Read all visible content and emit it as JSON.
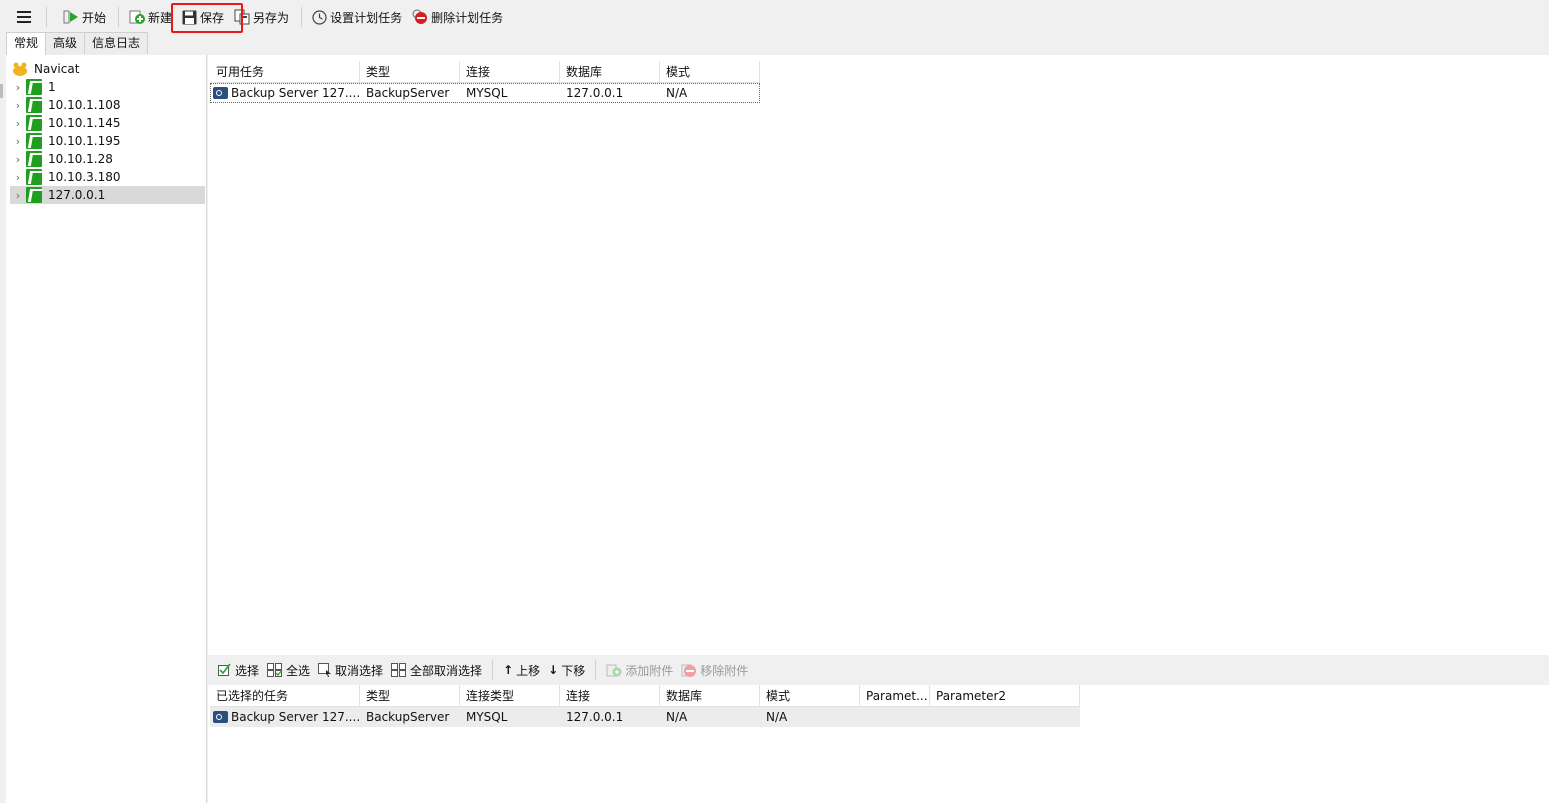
{
  "toolbar": {
    "start": "开始",
    "new": "新建",
    "save": "保存",
    "save_as": "另存为",
    "set_schedule": "设置计划任务",
    "delete_schedule": "删除计划任务"
  },
  "tabs": [
    "常规",
    "高级",
    "信息日志"
  ],
  "tree": {
    "root": "Navicat",
    "connections": [
      "1",
      "10.10.1.108",
      "10.10.1.145",
      "10.10.1.195",
      "10.10.1.28",
      "10.10.3.180",
      "127.0.0.1"
    ],
    "selected": "127.0.0.1"
  },
  "available_tasks": {
    "headers": [
      "可用任务",
      "类型",
      "连接",
      "数据库",
      "模式"
    ],
    "rows": [
      [
        "Backup Server 127....",
        "BackupServer",
        "MYSQL",
        "127.0.0.1",
        "N/A"
      ]
    ]
  },
  "bottom_toolbar": {
    "select": "选择",
    "select_all": "全选",
    "deselect": "取消选择",
    "deselect_all": "全部取消选择",
    "move_up": "上移",
    "move_down": "下移",
    "add_attachment": "添加附件",
    "remove_attachment": "移除附件"
  },
  "selected_tasks": {
    "headers": [
      "已选择的任务",
      "类型",
      "连接类型",
      "连接",
      "数据库",
      "模式",
      "Paramet...",
      "Parameter2"
    ],
    "rows": [
      [
        "Backup Server 127....",
        "BackupServer",
        "MYSQL",
        "127.0.0.1",
        "N/A",
        "N/A",
        "",
        ""
      ]
    ]
  },
  "colors": {
    "highlight_box": "#e61a1a",
    "mysql_green": "#1f9e1f",
    "selection_gray": "#d9d9d9"
  }
}
